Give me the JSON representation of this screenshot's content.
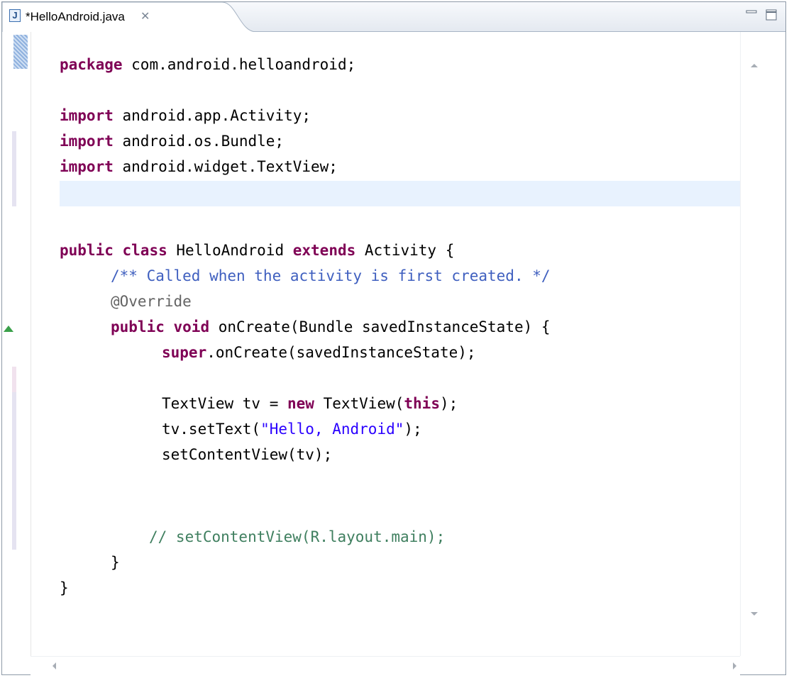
{
  "editor_tab": {
    "title": "*HelloAndroid.java",
    "icon_letter": "J",
    "close_glyph": "✕"
  },
  "code_lines": [
    "package com.android.helloandroid;",
    "",
    "import android.app.Activity;",
    "import android.os.Bundle;",
    "import android.widget.TextView;",
    "",
    "",
    "public class HelloAndroid extends Activity {",
    "    /** Called when the activity is first created. */",
    "    @Override",
    "    public void onCreate(Bundle savedInstanceState) {",
    "        super.onCreate(savedInstanceState);",
    "",
    "        TextView tv = new TextView(this);",
    "        tv.setText(\"Hello, Android\");",
    "        setContentView(tv);",
    "",
    "",
    "       // setContentView(R.layout.main);",
    "    }",
    "}"
  ],
  "tokens": {
    "kw_package": "package",
    "rest_package": " com.android.helloandroid;",
    "kw_import": "import",
    "rest_import1": " android.app.Activity;",
    "rest_import2": " android.os.Bundle;",
    "rest_import3": " android.widget.TextView;",
    "kw_public": "public",
    "kw_class": "class",
    "kw_extends": "extends",
    "class_name": " HelloAndroid ",
    "extends_rest": " Activity {",
    "javadoc": "/** Called when the activity is first created. */",
    "annotation": "@Override",
    "kw_void": "void",
    "method_sig": " onCreate(Bundle savedInstanceState) {",
    "kw_super": "super",
    "super_rest": ".onCreate(savedInstanceState);",
    "tv_decl_a": "TextView tv = ",
    "kw_new": "new",
    "tv_decl_b": " TextView(",
    "kw_this": "this",
    "tv_decl_c": ");",
    "settext_a": "tv.setText(",
    "settext_str": "\"Hello, Android\"",
    "settext_b": ");",
    "setcontent": "setContentView(tv);",
    "comment": "// setContentView(R.layout.main);",
    "close_method": "}",
    "close_class": "}"
  },
  "colors": {
    "keyword": "#7f0055",
    "javadoc": "#3f5fbf",
    "comment": "#3f7f5f",
    "string": "#2a00ff",
    "annotation": "#646464",
    "current_line": "#e8f2fe"
  }
}
